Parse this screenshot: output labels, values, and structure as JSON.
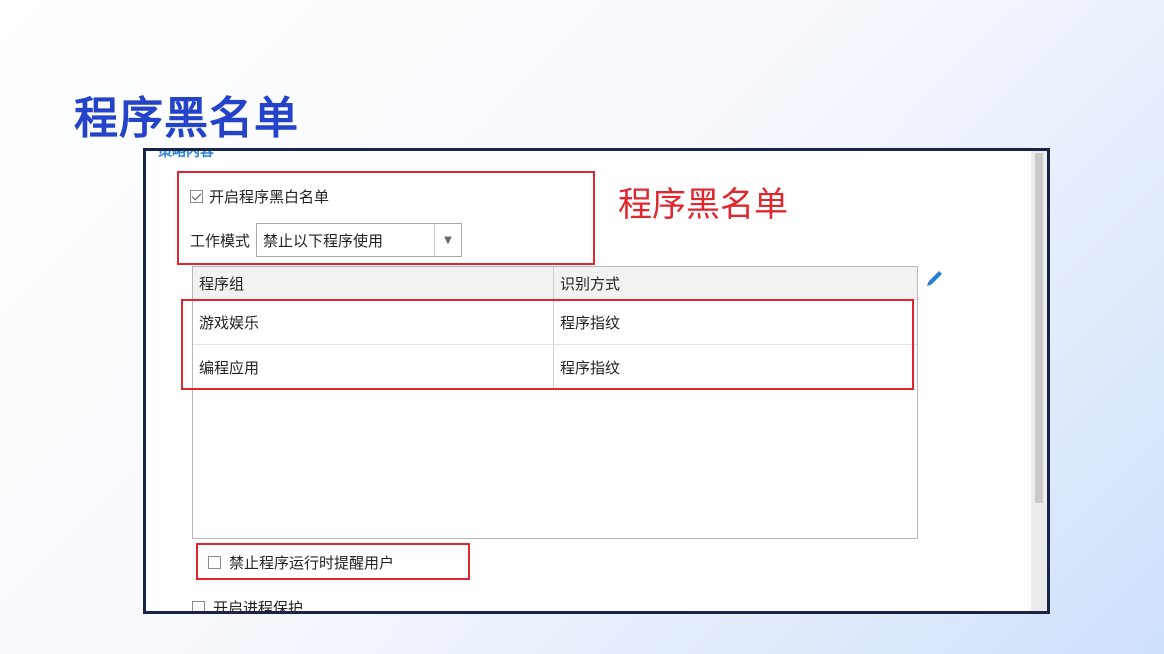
{
  "slide": {
    "title": "程序黑名单"
  },
  "panel": {
    "cutoff_label": "策略内容",
    "enable_whitelist": {
      "label": "开启程序黑白名单",
      "checked": true
    },
    "work_mode": {
      "label": "工作模式",
      "selected": "禁止以下程序使用"
    },
    "annotation_label": "程序黑名单",
    "table": {
      "columns": [
        "程序组",
        "识别方式"
      ],
      "rows": [
        [
          "游戏娱乐",
          "程序指纹"
        ],
        [
          "编程应用",
          "程序指纹"
        ]
      ]
    },
    "notify_user": {
      "label": "禁止程序运行时提醒用户",
      "checked": false
    },
    "process_protect": {
      "label": "开启进程保护",
      "checked": false
    }
  },
  "colors": {
    "title": "#2443c9",
    "annotation": "#e0262e",
    "panel_border": "#1a2447"
  },
  "icons": {
    "edit": "pencil-icon",
    "dropdown": "caret-down-icon"
  }
}
